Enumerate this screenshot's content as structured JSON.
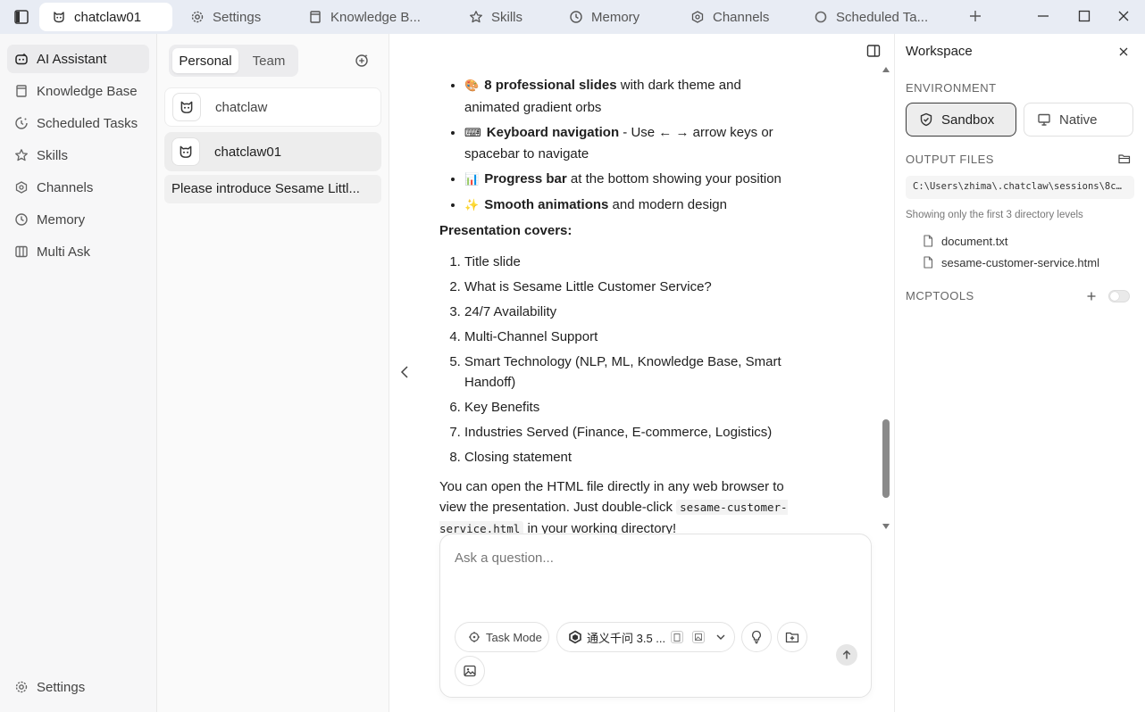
{
  "tabs": [
    {
      "label": "chatclaw01",
      "icon": "cat-face-icon",
      "active": true
    },
    {
      "label": "Settings",
      "icon": "gear-icon"
    },
    {
      "label": "Knowledge B...",
      "icon": "book-icon"
    },
    {
      "label": "Skills",
      "icon": "star-icon"
    },
    {
      "label": "Memory",
      "icon": "clock-icon"
    },
    {
      "label": "Channels",
      "icon": "channels-icon"
    },
    {
      "label": "Scheduled Ta...",
      "icon": "loading-circle-icon"
    }
  ],
  "sidebar": {
    "items": [
      {
        "label": "AI Assistant",
        "icon": "assistant-icon",
        "active": true
      },
      {
        "label": "Knowledge Base",
        "icon": "book-icon"
      },
      {
        "label": "Scheduled Tasks",
        "icon": "scheduled-icon"
      },
      {
        "label": "Skills",
        "icon": "star-icon"
      },
      {
        "label": "Channels",
        "icon": "channels-icon"
      },
      {
        "label": "Memory",
        "icon": "clock-icon"
      },
      {
        "label": "Multi Ask",
        "icon": "columns-icon"
      }
    ],
    "settings_label": "Settings"
  },
  "sessions": {
    "segments": [
      "Personal",
      "Team"
    ],
    "active_segment": "Personal",
    "agents": [
      {
        "name": "chatclaw"
      },
      {
        "name": "chatclaw01",
        "active": true
      }
    ],
    "preview": "Please introduce Sesame Littl..."
  },
  "chat": {
    "bullets": [
      {
        "emoji": "🎨",
        "bold": "8 professional slides",
        "rest": " with dark theme and animated gradient orbs"
      },
      {
        "emoji": "⌨",
        "bold": "Keyboard navigation",
        "rest": " - Use ← → arrow keys or spacebar to navigate"
      },
      {
        "emoji": "📊",
        "bold": "Progress bar",
        "rest": " at the bottom showing your position"
      },
      {
        "emoji": "✨",
        "bold": "Smooth animations",
        "rest": " and modern design"
      }
    ],
    "covers_heading": "Presentation covers:",
    "covers": [
      "Title slide",
      "What is Sesame Little Customer Service?",
      "24/7 Availability",
      "Multi-Channel Support",
      "Smart Technology (NLP, ML, Knowledge Base, Smart Handoff)",
      "Key Benefits",
      "Industries Served (Finance, E-commerce, Logistics)",
      "Closing statement"
    ],
    "closing_pre": "You can open the HTML file directly in any web browser to view the presentation. Just double-click ",
    "closing_code": "sesame-customer-service.html",
    "closing_post": " in your working directory!",
    "input_placeholder": "Ask a question...",
    "task_mode_label": "Task Mode",
    "model_label": "通义千问 3.5 ..."
  },
  "workspace": {
    "title": "Workspace",
    "environment_label": "ENVIRONMENT",
    "env_options": [
      "Sandbox",
      "Native"
    ],
    "env_selected": "Sandbox",
    "output_files_label": "OUTPUT FILES",
    "path": "C:\\Users\\zhima\\.chatclaw\\sessions\\8c7bb...",
    "hint": "Showing only the first 3 directory levels",
    "files": [
      "document.txt",
      "sesame-customer-service.html"
    ],
    "mcptools_label": "MCPTOOLS",
    "mcptools_enabled": false
  },
  "colors": {
    "tabbar_bg": "#e8ecf4",
    "sidebar_bg": "#f7f7f8",
    "active_item_bg": "#ebebed",
    "scroll_thumb": "#8a8a8a"
  }
}
